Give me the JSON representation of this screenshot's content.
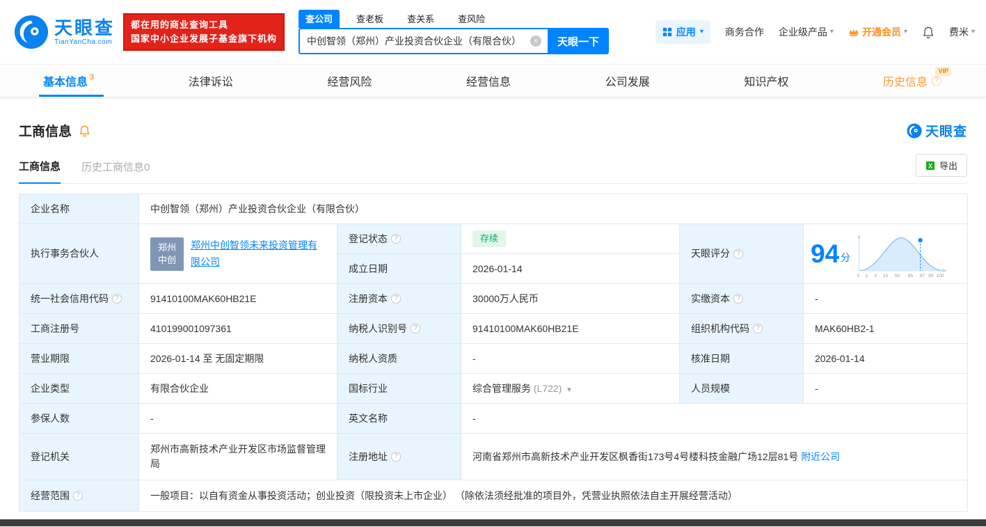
{
  "icons": {
    "help": "?",
    "caret": "▾",
    "clear": "×"
  },
  "header": {
    "logo_text": "天眼查",
    "logo_domain": "TianYanCha.com",
    "banner": {
      "line1": "都在用的商业查询工具",
      "line2": "国家中小企业发展子基金旗下机构"
    },
    "search": {
      "tabs": [
        {
          "label": "查公司"
        },
        {
          "label": "查老板"
        },
        {
          "label": "查关系"
        },
        {
          "label": "查风险"
        }
      ],
      "value": "中创智领（郑州）产业投资合伙企业（有限合伙）",
      "button": "天眼一下"
    },
    "menu": {
      "apps": "应用",
      "cooperation": "商务合作",
      "enterprise": "企业级产品",
      "vip": "开通会员",
      "user": "费米"
    }
  },
  "nav": {
    "tabs": [
      {
        "label": "基本信息",
        "count": "3"
      },
      {
        "label": "法律诉讼"
      },
      {
        "label": "经营风险"
      },
      {
        "label": "经营信息"
      },
      {
        "label": "公司发展"
      },
      {
        "label": "知识产权"
      },
      {
        "label": "历史信息",
        "badge": "VIP"
      }
    ]
  },
  "section": {
    "title": "工商信息",
    "brand": "天眼查",
    "subtab_active": "工商信息",
    "subtab_history": "历史工商信息0",
    "export": "导出"
  },
  "info": {
    "company_name_label": "企业名称",
    "company_name": "中创智领（郑州）产业投资合伙企业（有限合伙）",
    "partner_label": "执行事务合伙人",
    "partner_avatar_line1": "郑州",
    "partner_avatar_line2": "中创",
    "partner_name": "郑州中创智领未来投资管理有限公司",
    "status_label": "登记状态",
    "status_value": "存续",
    "founded_label": "成立日期",
    "founded_value": "2026-01-14",
    "score_label": "天眼评分",
    "score_value": "94",
    "score_unit": "分",
    "credit_code_label": "统一社会信用代码",
    "credit_code_value": "91410100MAK60HB21E",
    "reg_capital_label": "注册资本",
    "reg_capital_value": "30000万人民币",
    "paid_capital_label": "实缴资本",
    "paid_capital_value": "-",
    "reg_no_label": "工商注册号",
    "reg_no_value": "410199001097361",
    "taxpayer_id_label": "纳税人识别号",
    "taxpayer_id_value": "91410100MAK60HB21E",
    "org_code_label": "组织机构代码",
    "org_code_value": "MAK60HB2-1",
    "term_label": "营业期限",
    "term_value": "2026-01-14 至 无固定期限",
    "taxpayer_quality_label": "纳税人资质",
    "taxpayer_quality_value": "-",
    "approval_date_label": "核准日期",
    "approval_date_value": "2026-01-14",
    "company_type_label": "企业类型",
    "company_type_value": "有限合伙企业",
    "industry_label": "国标行业",
    "industry_value": "综合管理服务",
    "industry_code": "(L722)",
    "staff_label": "人员规模",
    "staff_value": "-",
    "insured_label": "参保人数",
    "insured_value": "-",
    "english_name_label": "英文名称",
    "english_name_value": "-",
    "authority_label": "登记机关",
    "authority_value": "郑州市高新技术产业开发区市场监督管理局",
    "address_label": "注册地址",
    "address_value": "河南省郑州市高新技术产业开发区枫香街173号4号楼科技金融广场12层81号",
    "address_link": "附近公司",
    "scope_label": "经营范围",
    "scope_value": "一般项目：以自有资金从事投资活动；创业投资（限投资未上市企业） （除依法须经批准的项目外，凭营业执照依法自主开展经营活动）"
  },
  "score_chart": {
    "axis_labels": [
      "0",
      "1",
      "3",
      "15",
      "50",
      "85",
      "97",
      "99",
      "100"
    ]
  }
}
